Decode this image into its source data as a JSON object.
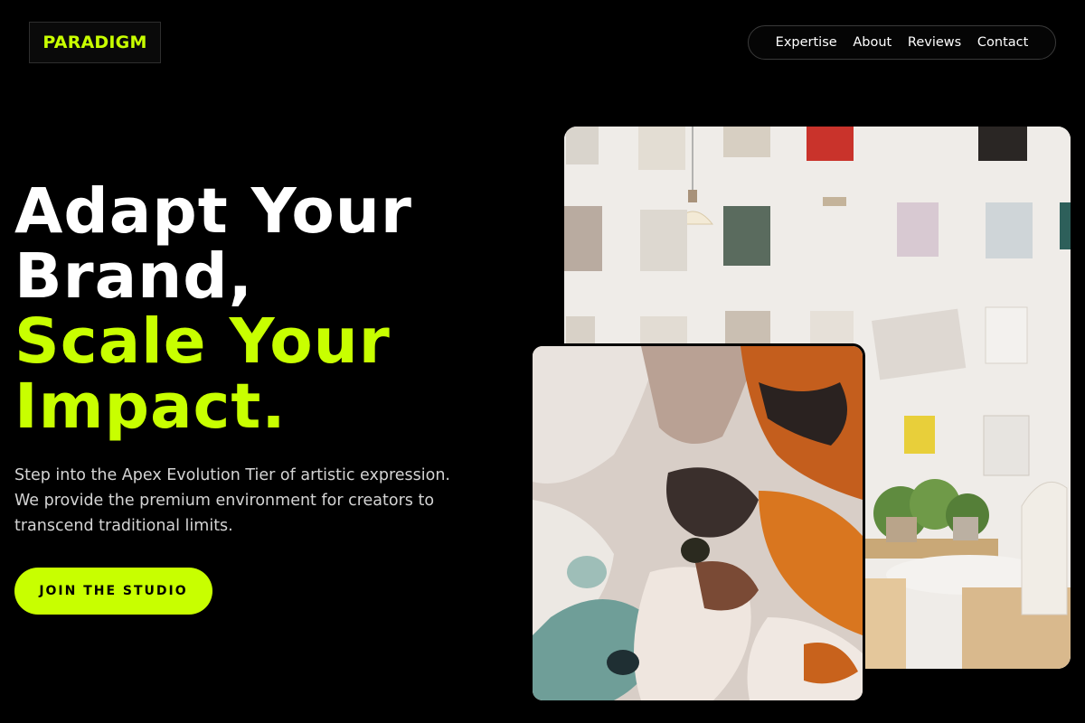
{
  "brand": {
    "logo": "PARADIGM",
    "accent": "#c8ff00"
  },
  "nav": {
    "items": [
      "Expertise",
      "About",
      "Reviews",
      "Contact"
    ]
  },
  "hero": {
    "title_line1": "Adapt Your",
    "title_line2": "Brand,",
    "title_line3": "Scale Your",
    "title_line4": "Impact.",
    "subtitle_line1": "Step into the Apex Evolution Tier of artistic expression.",
    "subtitle_line2": "We provide the premium environment for creators to",
    "subtitle_line3": "transcend traditional limits.",
    "cta_label": "JOIN THE STUDIO"
  },
  "images": {
    "back": "studio-wall-photo",
    "front": "abstract-paint-texture"
  }
}
